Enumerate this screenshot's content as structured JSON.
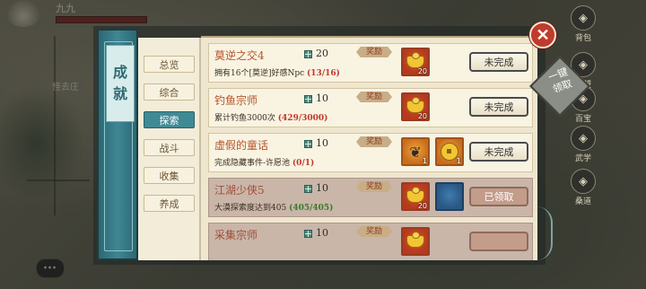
{
  "background": {
    "player_name": "九九",
    "area_label": "怪去庄",
    "rail_menu": [
      {
        "label": "背包",
        "icon": "bag-icon"
      },
      {
        "label": "声望",
        "icon": "reputation-icon"
      },
      {
        "label": "百宝",
        "icon": "treasure-icon"
      },
      {
        "label": "武学",
        "icon": "martial-icon"
      },
      {
        "label": "桑道",
        "icon": "path-icon"
      }
    ]
  },
  "panel": {
    "title": [
      "成",
      "就"
    ],
    "tabs": [
      {
        "label": "总览",
        "active": false
      },
      {
        "label": "综合",
        "active": false
      },
      {
        "label": "探索",
        "active": true
      },
      {
        "label": "战斗",
        "active": false
      },
      {
        "label": "收集",
        "active": false
      },
      {
        "label": "养成",
        "active": false
      }
    ],
    "reward_tag_label": "奖励",
    "claim_all_label": [
      "一键",
      "领取"
    ],
    "close_label": "✕",
    "achievements": [
      {
        "name": "莫逆之交4",
        "desc": "拥有16个[莫逆]好感Npc",
        "progress": "(13/16)",
        "completed": false,
        "points": "20",
        "rewards": [
          {
            "icon": "silver-ingot-icon",
            "count": "20",
            "kind": "red"
          }
        ],
        "button": "未完成"
      },
      {
        "name": "钓鱼宗师",
        "desc": "累计钓鱼3000次",
        "progress": "(429/3000)",
        "completed": false,
        "points": "10",
        "rewards": [
          {
            "icon": "silver-ingot-icon",
            "count": "20",
            "kind": "red"
          }
        ],
        "button": "未完成"
      },
      {
        "name": "虚假的童话",
        "desc": "完成隐藏事件-许愿池",
        "progress": "(0/1)",
        "completed": false,
        "points": "10",
        "rewards": [
          {
            "icon": "pendant-icon",
            "count": "1",
            "kind": "gold"
          },
          {
            "icon": "coin-icon",
            "count": "1",
            "kind": "gold"
          }
        ],
        "button": "未完成"
      },
      {
        "name": "江湖少侠5",
        "desc": "大漠探索度达到405",
        "progress": "(405/405)",
        "completed": true,
        "points": "10",
        "rewards": [
          {
            "icon": "silver-ingot-icon",
            "count": "20",
            "kind": "red"
          },
          {
            "icon": "scroll-icon",
            "count": "",
            "kind": "blue"
          }
        ],
        "button": "已领取"
      },
      {
        "name": "采集宗师",
        "desc": "",
        "progress": "",
        "completed": true,
        "points": "10",
        "rewards": [
          {
            "icon": "silver-ingot-icon",
            "count": "",
            "kind": "red"
          }
        ],
        "button": ""
      }
    ]
  }
}
